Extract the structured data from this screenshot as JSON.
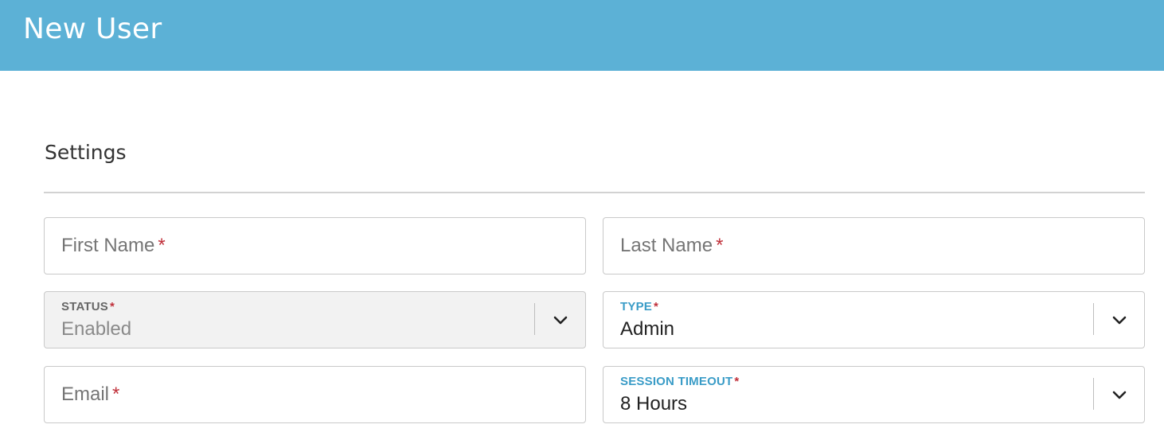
{
  "header": {
    "title": "New User"
  },
  "section": {
    "title": "Settings"
  },
  "fields": {
    "first_name": {
      "placeholder": "First Name",
      "required": "*"
    },
    "last_name": {
      "placeholder": "Last Name",
      "required": "*"
    },
    "status": {
      "label": "STATUS",
      "required": "*",
      "value": "Enabled",
      "disabled": true
    },
    "type": {
      "label": "TYPE",
      "required": "*",
      "value": "Admin"
    },
    "email": {
      "placeholder": "Email",
      "required": "*"
    },
    "session_timeout": {
      "label": "SESSION TIMEOUT",
      "required": "*",
      "value": "8 Hours"
    }
  },
  "colors": {
    "header_bg": "#5cb1d6",
    "required": "#c0303a",
    "label_accent": "#3a9cc7"
  },
  "icons": {
    "dropdown": "chevron-down-icon"
  }
}
